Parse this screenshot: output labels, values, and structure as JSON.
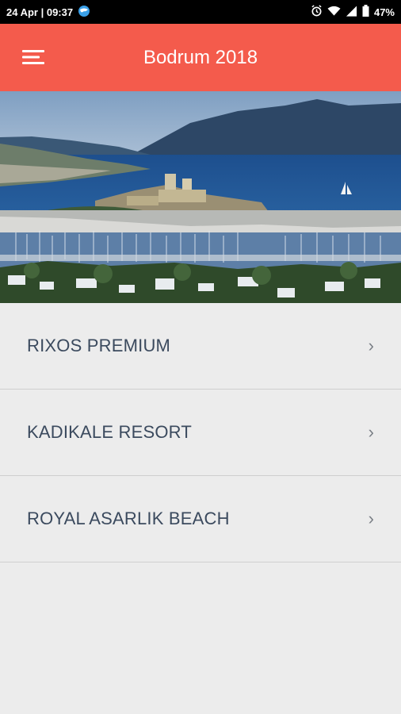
{
  "status_bar": {
    "datetime": "24 Apr | 09:37",
    "battery": "47%",
    "icons": [
      "globe-icon",
      "alarm-icon",
      "wifi-icon",
      "signal-icon",
      "battery-icon"
    ]
  },
  "app_bar": {
    "title": "Bodrum 2018",
    "menu_icon": "hamburger-menu-icon",
    "background_color": "#f45b4c"
  },
  "hero": {
    "description_icon": "bodrum-castle-harbor-photo"
  },
  "hotels": [
    {
      "label": "RIXOS PREMIUM",
      "chevron": "›"
    },
    {
      "label": "KADIKALE RESORT",
      "chevron": "›"
    },
    {
      "label": "ROYAL ASARLIK BEACH",
      "chevron": "›"
    }
  ]
}
